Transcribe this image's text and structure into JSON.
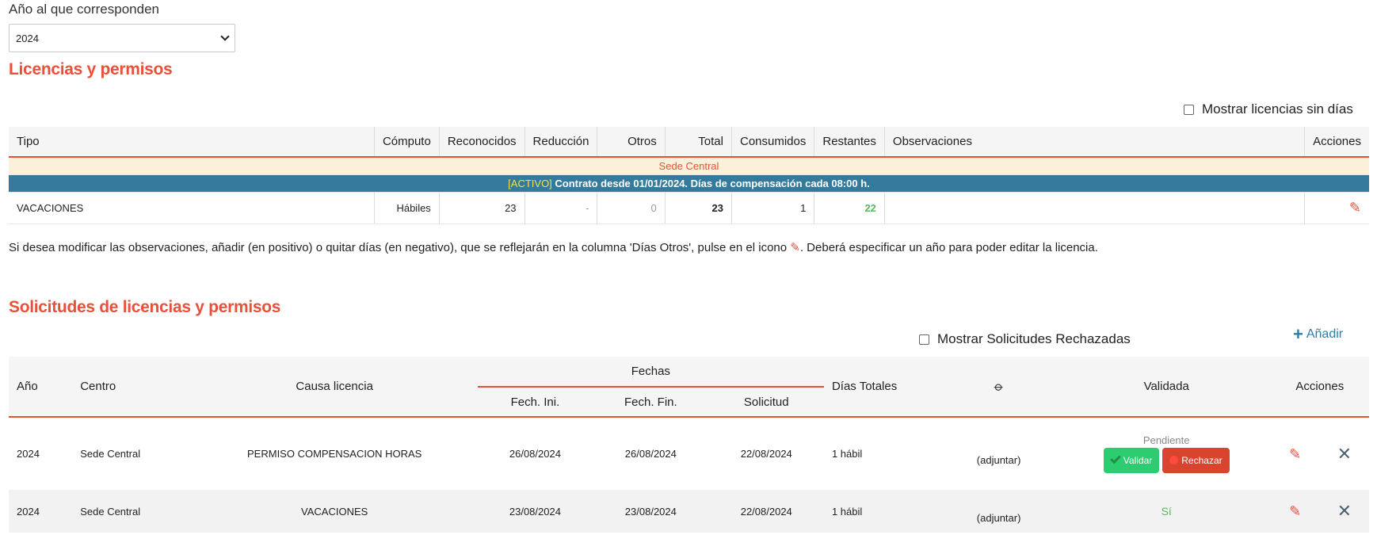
{
  "year": {
    "label": "Año al que corresponden",
    "selected": "2024"
  },
  "licencias": {
    "title": "Licencias y permisos",
    "show_no_days_label": "Mostrar licencias sin días",
    "columns": [
      "Tipo",
      "Cómputo",
      "Reconocidos",
      "Reducción",
      "Otros",
      "Total",
      "Consumidos",
      "Restantes",
      "Observaciones",
      "Acciones"
    ],
    "sede": "Sede Central",
    "contrato_tag": "[ACTIVO]",
    "contrato_text": " Contrato desde 01/01/2024. Días de compensación cada 08:00 h.",
    "rows": [
      {
        "tipo": "VACACIONES",
        "computo": "Hábiles",
        "reconocidos": "23",
        "reduccion": "-",
        "otros": "0",
        "total": "23",
        "consumidos": "1",
        "restantes": "22",
        "observaciones": ""
      }
    ],
    "note_before": "Si desea modificar las observaciones, añadir (en positivo) o quitar días (en negativo), que se reflejarán en la columna 'Días Otros', pulse en el icono ",
    "note_after": ". Deberá especificar un año para poder editar la licencia."
  },
  "solicitudes": {
    "title": "Solicitudes de licencias y permisos",
    "show_rejected_label": "Mostrar Solicitudes Rechazadas",
    "add_label": "Añadir",
    "columns": {
      "anio": "Año",
      "centro": "Centro",
      "causa": "Causa licencia",
      "fechas": "Fechas",
      "fech_ini": "Fech. Ini.",
      "fech_fin": "Fech. Fin.",
      "solicitud": "Solicitud",
      "dias": "Días Totales",
      "validada": "Validada",
      "acciones": "Acciones"
    },
    "rows": [
      {
        "anio": "2024",
        "centro": "Sede Central",
        "causa": "PERMISO COMPENSACION HORAS",
        "ini": "26/08/2024",
        "fin": "26/08/2024",
        "solicitud": "22/08/2024",
        "dias": "1 hábil",
        "adjuntar": "(adjuntar)",
        "estado": "Pendiente",
        "validar": "Validar",
        "rechazar": "Rechazar"
      },
      {
        "anio": "2024",
        "centro": "Sede Central",
        "causa": "VACACIONES",
        "ini": "23/08/2024",
        "fin": "23/08/2024",
        "solicitud": "22/08/2024",
        "dias": "1 hábil",
        "adjuntar": "(adjuntar)",
        "estado": "Sí"
      }
    ]
  },
  "icons": {
    "edit": "pencil-icon",
    "delete": "close-icon",
    "attach": "paperclip-icon",
    "add": "plus-icon"
  },
  "colors": {
    "accent": "#e8503a",
    "contract_bar": "#337a9c",
    "validate": "#2ecc71",
    "reject": "#d9442f",
    "link": "#2a7fa8"
  }
}
